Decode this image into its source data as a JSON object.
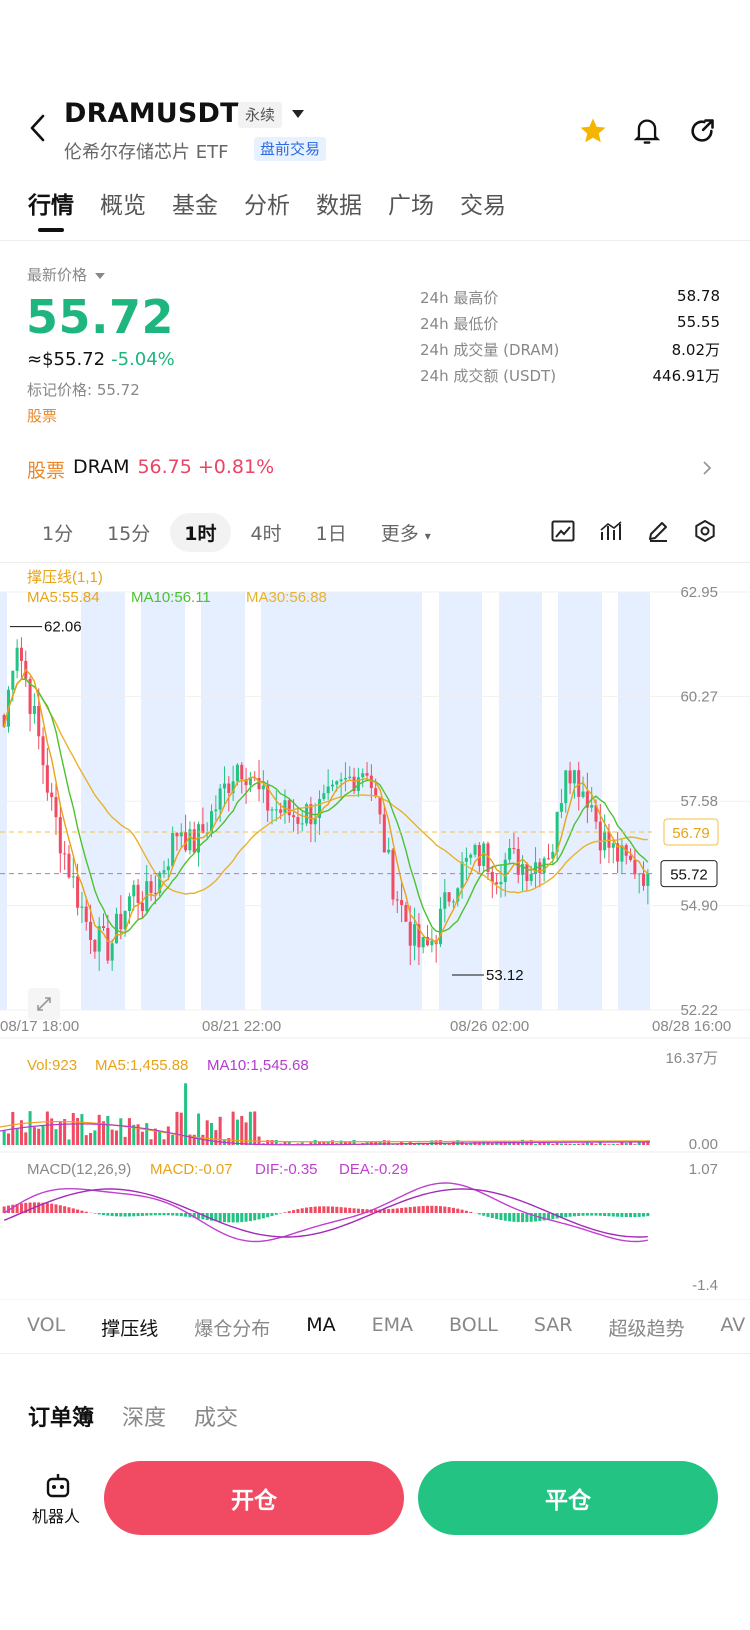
{
  "header": {
    "symbol": "DRAMUSDT",
    "contract_type": "永续",
    "name": "伦希尔存储芯片 ETF",
    "badge": "盘前交易",
    "icons": [
      "back-arrow-icon",
      "star-icon",
      "bell-icon",
      "share-icon"
    ],
    "star_color": "#f5b400"
  },
  "tabs": [
    "行情",
    "概览",
    "基金",
    "分析",
    "数据",
    "广场",
    "交易"
  ],
  "price": {
    "label": "最新价格",
    "last": "55.72",
    "usd": "≈$55.72",
    "change_pct": "-5.04%",
    "mark_price": "标记价格: 55.72",
    "asset_type": "股票",
    "stats": [
      {
        "k": "24h 最高价",
        "v": "58.78"
      },
      {
        "k": "24h 最低价",
        "v": "55.55"
      },
      {
        "k": "24h 成交量 (DRAM)",
        "v": "8.02万"
      },
      {
        "k": "24h 成交额 (USDT)",
        "v": "446.91万"
      }
    ]
  },
  "stock": {
    "label": "股票",
    "ticker": "DRAM",
    "price": "56.75",
    "change": "+0.81%"
  },
  "periods": [
    "1分",
    "15分",
    "1时",
    "4时",
    "1日",
    "更多"
  ],
  "chart_tools": [
    "fullscreen-chart-icon",
    "indicator-icon",
    "draw-pen-icon",
    "settings-gear-icon"
  ],
  "chart_data": {
    "type": "candlestick",
    "indicator_label": "撑压线(1,1)",
    "ma_legend": [
      {
        "text": "MA5:55.84",
        "color": "#e8a317"
      },
      {
        "text": "MA10:56.11",
        "color": "#4cc22e"
      },
      {
        "text": "MA30:56.88",
        "color": "#e8b22a"
      }
    ],
    "y_ticks": [
      "62.95",
      "60.27",
      "57.58",
      "54.90",
      "52.22"
    ],
    "ylim": [
      52.22,
      62.95
    ],
    "x_ticks": [
      "08/17 18:00",
      "08/21 22:00",
      "08/26 02:00",
      "08/28 16:00"
    ],
    "high_marker": "62.06",
    "low_marker": "53.12",
    "support_level": "56.79",
    "current_price": "55.72",
    "close_path": [
      59.5,
      61.9,
      60.5,
      59.1,
      57.5,
      56.4,
      55.4,
      54.5,
      54.0,
      53.8,
      54.6,
      55.3,
      55.0,
      55.5,
      56.2,
      57.0,
      56.4,
      56.8,
      57.4,
      58.0,
      58.6,
      58.3,
      57.6,
      57.4,
      57.3,
      57.2,
      57.3,
      57.4,
      57.6,
      58.0,
      58.3,
      58.5,
      57.2,
      55.7,
      54.8,
      54.0,
      53.7,
      54.3,
      55.2,
      55.8,
      56.1,
      56.2,
      55.8,
      56.1,
      56.0,
      55.9,
      56.2,
      56.5,
      58.7,
      58.1,
      57.7,
      56.7,
      56.3,
      56.0,
      55.9,
      55.72
    ],
    "volume": {
      "legend": [
        {
          "text": "Vol:923",
          "color": "#e8a317"
        },
        {
          "text": "MA5:1,455.88",
          "color": "#e8a317"
        },
        {
          "text": "MA10:1,545.68",
          "color": "#b43bd0"
        }
      ],
      "y_ticks": [
        "16.37万",
        "0.00"
      ]
    },
    "macd": {
      "legend": [
        {
          "text": "MACD(12,26,9)",
          "color": "#888888"
        },
        {
          "text": "MACD:-0.07",
          "color": "#e8a317"
        },
        {
          "text": "DIF:-0.35",
          "color": "#c03fd0"
        },
        {
          "text": "DEA:-0.29",
          "color": "#c03fd0"
        }
      ],
      "y_ticks": [
        "1.07",
        "-1.4"
      ]
    },
    "colors": {
      "up": "#23c384",
      "down": "#f04b63",
      "band": "#e6efff"
    }
  },
  "indicators": [
    "VOL",
    "撑压线",
    "爆仓分布",
    "MA",
    "EMA",
    "BOLL",
    "SAR",
    "超级趋势",
    "AV"
  ],
  "orderbook_tabs": [
    "订单簿",
    "深度",
    "成交"
  ],
  "footer": {
    "robot": "机器人",
    "open": "开仓",
    "close": "平仓"
  }
}
